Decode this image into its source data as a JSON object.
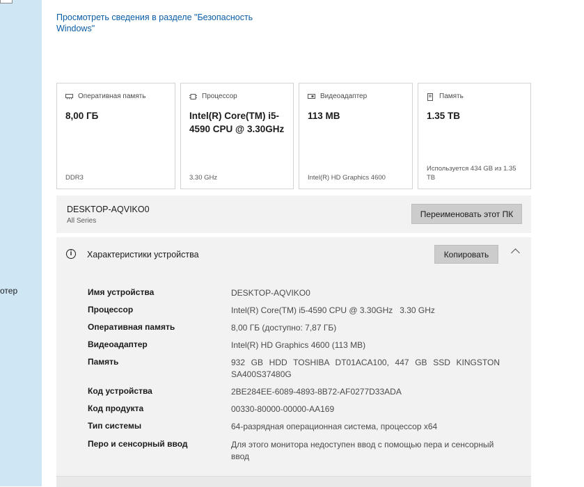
{
  "sidebar": {
    "partial_label": "отер"
  },
  "security_link": "Просмотреть сведения в разделе \"Безопасность Windows\"",
  "cards": [
    {
      "icon": "ram-icon",
      "title": "Оперативная память",
      "value": "8,00 ГБ",
      "sub": "DDR3"
    },
    {
      "icon": "cpu-icon",
      "title": "Процессор",
      "value": "Intel(R) Core(TM) i5-4590 CPU @ 3.30GHz",
      "sub": "3.30 GHz"
    },
    {
      "icon": "gpu-icon",
      "title": "Видеоадаптер",
      "value": "113 MB",
      "sub": "Intel(R) HD Graphics 4600"
    },
    {
      "icon": "storage-icon",
      "title": "Память",
      "value": "1.35 TB",
      "sub": "Используется 434 GB из 1.35 TB"
    }
  ],
  "pc": {
    "name": "DESKTOP-AQVIKO0",
    "series": "All Series",
    "rename_label": "Переименовать этот ПК"
  },
  "specs": {
    "title": "Характеристики устройства",
    "copy_label": "Копировать",
    "rows": [
      {
        "label": "Имя устройства",
        "value": "DESKTOP-AQVIKO0"
      },
      {
        "label": "Процессор",
        "value": "Intel(R) Core(TM) i5-4590 CPU @ 3.30GHz   3.30 GHz"
      },
      {
        "label": "Оперативная память",
        "value": "8,00 ГБ (доступно: 7,87 ГБ)"
      },
      {
        "label": "Видеоадаптер",
        "value": "Intel(R) HD Graphics 4600 (113 MB)"
      },
      {
        "label": "Память",
        "value": "932 GB HDD TOSHIBA DT01ACA100, 447 GB SSD KINGSTON SA400S37480G"
      },
      {
        "label": "Код устройства",
        "value": "2BE284EE-6089-4893-8B72-AF0277D33ADA"
      },
      {
        "label": "Код продукта",
        "value": "00330-80000-00000-AA169"
      },
      {
        "label": "Тип системы",
        "value": "64-разрядная операционная система, процессор x64"
      },
      {
        "label": "Перо и сенсорный ввод",
        "value": "Для этого монитора недоступен ввод с помощью пера и сенсорный ввод"
      }
    ]
  }
}
